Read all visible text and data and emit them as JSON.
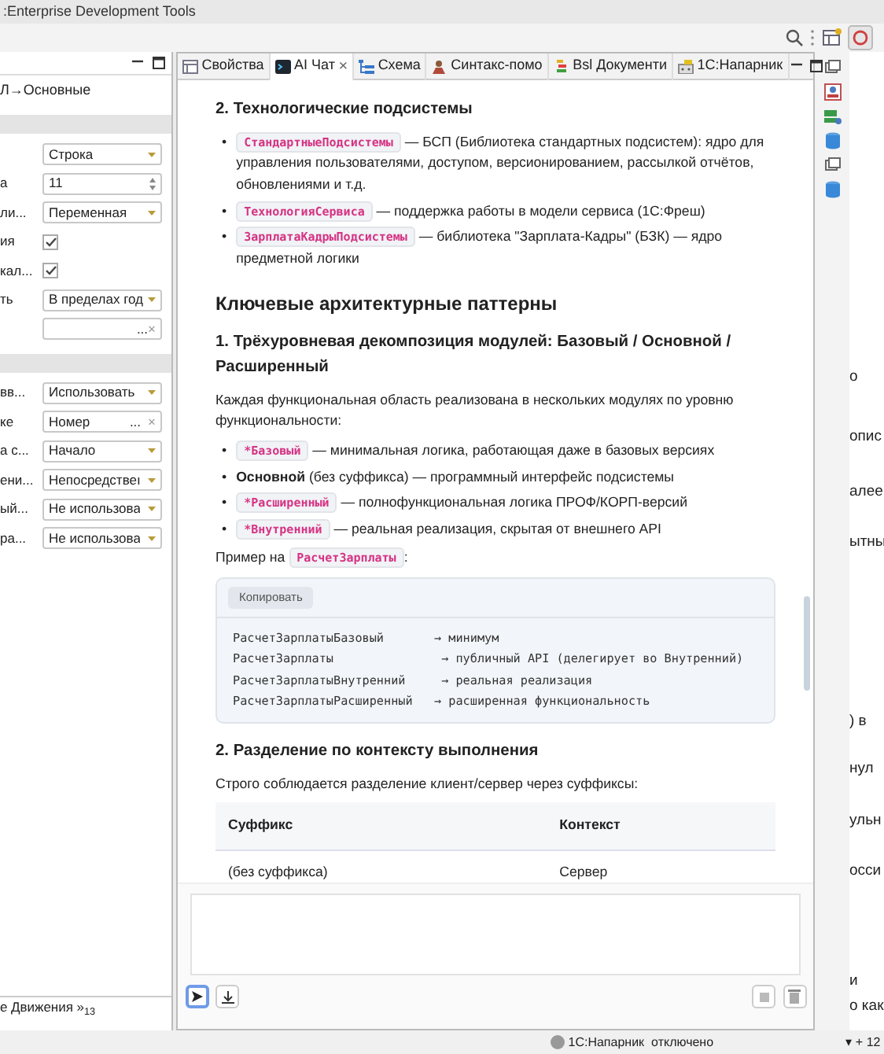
{
  "window": {
    "title": ":Enterprise Development Tools"
  },
  "properties_panel": {
    "breadcrumb": "Л→Основные",
    "sections": [
      {
        "rows": [
          {
            "kind": "select",
            "value": "Строка"
          },
          {
            "kind": "spin",
            "label": "а",
            "value": "11"
          },
          {
            "kind": "select",
            "label": "ли...",
            "value": "Переменная"
          },
          {
            "kind": "check",
            "label": "ия",
            "checked": true
          },
          {
            "kind": "check",
            "label": "кал...",
            "checked": true
          },
          {
            "kind": "select",
            "label": "ть",
            "value": "В пределах год"
          },
          {
            "kind": "pick",
            "value": "...",
            "clear": "×"
          }
        ]
      },
      {
        "rows": [
          {
            "kind": "select",
            "label": "вв...",
            "value": "Использовать"
          },
          {
            "kind": "pick",
            "label": "ке",
            "value": "Номер",
            "more": "...",
            "clear": "×"
          },
          {
            "kind": "select",
            "label": "а с...",
            "value": "Начало"
          },
          {
            "kind": "select",
            "label": "ени...",
            "value": "Непосредствеı"
          },
          {
            "kind": "select",
            "label": "ый...",
            "value": "Не использова"
          },
          {
            "kind": "select",
            "label": "ра...",
            "value": "Не использова"
          }
        ]
      }
    ],
    "bottom_tabs": [
      "е",
      "Движения"
    ],
    "overflow": {
      "mark": "»",
      "count": "13"
    }
  },
  "tabs": [
    {
      "label": "Свойства",
      "selected": false
    },
    {
      "label": "AI Чат",
      "selected": true,
      "close": "×"
    },
    {
      "label": "Схема",
      "selected": false
    },
    {
      "label": "Синтакс-помо",
      "selected": false
    },
    {
      "label": "Bsl Документи",
      "selected": false
    },
    {
      "label": "1С:Напарник",
      "selected": false
    }
  ],
  "chat": [
    {
      "kind": "h3",
      "text": "2. Технологические подсистемы"
    },
    {
      "kind": "ul",
      "items": [
        {
          "bullet": "•",
          "parts": [
            {
              "kind": "code",
              "text": "СтандартныеПодсистемы"
            },
            {
              "kind": "text",
              "text": " — БСП (Библиотека стандартных подсистем): ядро для управления пользователями, доступом, версионированием, рассылкой отчётов, обновлениями и т.д."
            }
          ]
        },
        {
          "bullet": "•",
          "parts": [
            {
              "kind": "code",
              "text": "ТехнологияСервиса"
            },
            {
              "kind": "text",
              "text": " — поддержка работы в модели сервиса (1С:Фреш)"
            }
          ]
        },
        {
          "bullet": "•",
          "parts": [
            {
              "kind": "code",
              "text": "ЗарплатаКадрыПодсистемы"
            },
            {
              "kind": "text",
              "text": " — библиотека \"Зарплата-Кадры\" (БЗК) — ядро предметной логики"
            }
          ]
        }
      ]
    },
    {
      "kind": "h2",
      "text": "Ключевые архитектурные паттерны"
    },
    {
      "kind": "h3",
      "text": "1. Трёхуровневая декомпозиция модулей: Базовый / Основной / Расширенный"
    },
    {
      "kind": "p",
      "parts": [
        {
          "kind": "text",
          "text": "Каждая функциональная область реализована в нескольких модулях по уровню функциональности:"
        }
      ]
    },
    {
      "kind": "ul",
      "items": [
        {
          "bullet": "•",
          "parts": [
            {
              "kind": "code",
              "text": "*Базовый"
            },
            {
              "kind": "text",
              "text": " — минимальная логика, работающая даже в базовых версиях"
            }
          ]
        },
        {
          "bullet": "•",
          "parts": [
            {
              "kind": "text",
              "text": "**Основной** (без суффикса) — программный интерфейс подсистемы"
            }
          ]
        },
        {
          "bullet": "•",
          "parts": [
            {
              "kind": "code",
              "text": "*Расширенный"
            },
            {
              "kind": "text",
              "text": " — полнофункциональная логика ПРОФ/КОРП-версий"
            }
          ]
        },
        {
          "bullet": "•",
          "parts": [
            {
              "kind": "code",
              "text": "*Внутренний"
            },
            {
              "kind": "text",
              "text": " — реальная реализация, скрытая от внешнего API"
            }
          ]
        }
      ]
    },
    {
      "kind": "p",
      "parts": [
        {
          "kind": "text",
          "text": "Пример на "
        },
        {
          "kind": "code",
          "text": "РасчетЗарплаты"
        },
        {
          "kind": "text",
          "text": ":"
        }
      ]
    },
    {
      "kind": "code",
      "copy": "Копировать",
      "lines": [
        "РасчетЗарплатыБазовый       → минимум",
        "РасчетЗарплаты               → публичный API (делегирует во Внутренний)",
        "РасчетЗарплатыВнутренний     → реальная реализация",
        "РасчетЗарплатыРасширенный   → расширенная функциональность"
      ]
    },
    {
      "kind": "h3",
      "text": "2. Разделение по контексту выполнения"
    },
    {
      "kind": "p",
      "parts": [
        {
          "kind": "text",
          "text": "Строго соблюдается разделение клиент/сервер через суффиксы:"
        }
      ]
    },
    {
      "kind": "table",
      "columns": [
        "Суффикс",
        "Контекст"
      ],
      "rows": [
        [
          "(без суффикса)",
          "Сервер"
        ]
      ]
    }
  ],
  "background_window": {
    "fragments": [
      "о",
      "опис",
      "алее",
      "ытны",
      ") в",
      "нул",
      "ульн",
      "осси",
      "и",
      "о как"
    ],
    "footer": [
      "▾",
      "+",
      "12"
    ]
  },
  "status_bar": {
    "service": "1С:Напарник",
    "state": "отключено"
  }
}
